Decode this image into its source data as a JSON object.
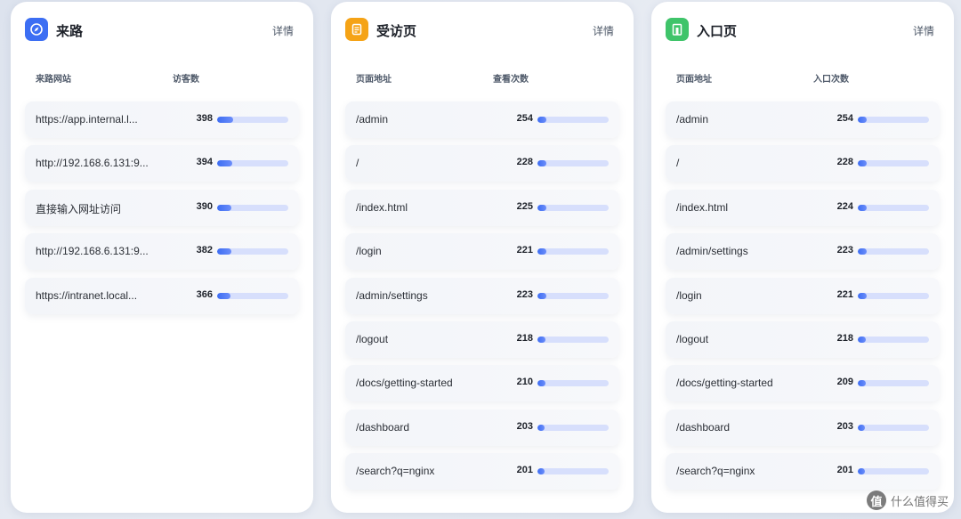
{
  "panels": [
    {
      "id": "referrers",
      "title": "来路",
      "icon": "compass-icon",
      "icon_color": "#3c6ef3",
      "detail": "详情",
      "col_label": "来路网站",
      "col_value": "访客数",
      "rows": [
        {
          "label": "https://app.internal.l...",
          "count": "398",
          "fill": 0.22
        },
        {
          "label": "http://192.168.6.131:9...",
          "count": "394",
          "fill": 0.21
        },
        {
          "label": "直接输入网址访问",
          "count": "390",
          "fill": 0.2
        },
        {
          "label": "http://192.168.6.131:9...",
          "count": "382",
          "fill": 0.2
        },
        {
          "label": "https://intranet.local...",
          "count": "366",
          "fill": 0.19
        }
      ]
    },
    {
      "id": "visited-pages",
      "title": "受访页",
      "icon": "document-icon",
      "icon_color": "#f5a316",
      "detail": "详情",
      "col_label": "页面地址",
      "col_value": "查看次数",
      "rows": [
        {
          "label": "/admin",
          "count": "254",
          "fill": 0.13
        },
        {
          "label": "/",
          "count": "228",
          "fill": 0.12
        },
        {
          "label": "/index.html",
          "count": "225",
          "fill": 0.12
        },
        {
          "label": "/login",
          "count": "221",
          "fill": 0.12
        },
        {
          "label": "/admin/settings",
          "count": "223",
          "fill": 0.12
        },
        {
          "label": "/logout",
          "count": "218",
          "fill": 0.11
        },
        {
          "label": "/docs/getting-started",
          "count": "210",
          "fill": 0.11
        },
        {
          "label": "/dashboard",
          "count": "203",
          "fill": 0.1
        },
        {
          "label": "/search?q=nginx",
          "count": "201",
          "fill": 0.1
        }
      ]
    },
    {
      "id": "entry-pages",
      "title": "入口页",
      "icon": "door-icon",
      "icon_color": "#3fc46a",
      "detail": "详情",
      "col_label": "页面地址",
      "col_value": "入口次数",
      "rows": [
        {
          "label": "/admin",
          "count": "254",
          "fill": 0.13
        },
        {
          "label": "/",
          "count": "228",
          "fill": 0.12
        },
        {
          "label": "/index.html",
          "count": "224",
          "fill": 0.12
        },
        {
          "label": "/admin/settings",
          "count": "223",
          "fill": 0.12
        },
        {
          "label": "/login",
          "count": "221",
          "fill": 0.12
        },
        {
          "label": "/logout",
          "count": "218",
          "fill": 0.11
        },
        {
          "label": "/docs/getting-started",
          "count": "209",
          "fill": 0.11
        },
        {
          "label": "/dashboard",
          "count": "203",
          "fill": 0.1
        },
        {
          "label": "/search?q=nginx",
          "count": "201",
          "fill": 0.1
        }
      ]
    }
  ],
  "watermark": {
    "logo": "值",
    "text": "什么值得买"
  }
}
